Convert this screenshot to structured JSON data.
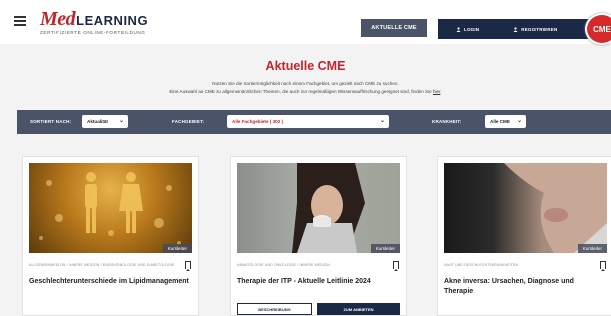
{
  "header": {
    "logo_med": "Med",
    "logo_learning": "LEARNING",
    "logo_sub": "ZERTIFIZIERTE ONLINE-FORTBILDUNG",
    "btn_aktuelle": "AKTUELLE CME",
    "login": "LOGIN",
    "register": "REGISTRIEREN",
    "badge": "CME"
  },
  "intro": {
    "title": "Aktuelle CME",
    "line1": "Nutzen Sie die Sortiermöglichkeit nach einem Fachgebiet, um gezielt nach CME zu suchen.",
    "line2": "Eine Auswahl an CME zu allgemeinärztlichen Themen, die auch zur regelmäßigen Wissensauffrischung geeignet sind, finden Sie",
    "link": "hier"
  },
  "filters": {
    "sort_label": "SORTIERT NACH:",
    "sort_value": "Aktualität",
    "fach_label": "FACHGEBIET:",
    "fach_value": "Alle Fachgebiete ( 302 )",
    "krank_label": "KRANKHEIT:",
    "krank_value": "Alle CME"
  },
  "cards": [
    {
      "tag": "Kursleiter",
      "category": "ALLGEMEINMEDIZIN / INNERE MEDIZIN / ENDOKRINOLOGIE UND DIABETOLOGIE",
      "title": "Geschlechterunterschiede im Lipidmanagement"
    },
    {
      "tag": "Kursleiter",
      "category": "HÄMATOLOGIE UND ONKOLOGIE / INNERE MEDIZIN",
      "title": "Therapie der ITP - Aktuelle Leitlinie 2024",
      "btn_outline": "BESCHREIBUNG",
      "btn_solid": "ZUM ANBIETEN"
    },
    {
      "tag": "Kursleiter",
      "category": "HAUT UND GESCHLECHTSKRANKHEITEN",
      "title": "Akne inversa: Ursachen, Diagnose und Therapie"
    }
  ],
  "icons": {
    "menu": "hamburger-icon",
    "login": "user-icon",
    "register": "user-plus-icon",
    "search": "search-icon",
    "bookmark": "bookmark-icon"
  },
  "colors": {
    "brand_red": "#c0262d",
    "navy": "#1c2946",
    "slate": "#4b5368"
  }
}
